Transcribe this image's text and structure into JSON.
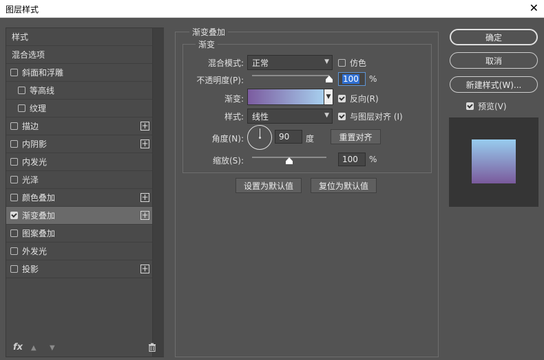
{
  "window": {
    "title": "图层样式",
    "close_glyph": "✕"
  },
  "left_panel": {
    "items": [
      {
        "label": "样式",
        "type": "header"
      },
      {
        "label": "混合选项",
        "type": "header"
      },
      {
        "label": "斜面和浮雕",
        "checked": false,
        "indent": 0,
        "plus": false
      },
      {
        "label": "等高线",
        "checked": false,
        "indent": 1,
        "plus": false
      },
      {
        "label": "纹理",
        "checked": false,
        "indent": 1,
        "plus": false
      },
      {
        "label": "描边",
        "checked": false,
        "indent": 0,
        "plus": true
      },
      {
        "label": "内阴影",
        "checked": false,
        "indent": 0,
        "plus": true
      },
      {
        "label": "内发光",
        "checked": false,
        "indent": 0,
        "plus": false
      },
      {
        "label": "光泽",
        "checked": false,
        "indent": 0,
        "plus": false
      },
      {
        "label": "颜色叠加",
        "checked": false,
        "indent": 0,
        "plus": true
      },
      {
        "label": "渐变叠加",
        "checked": true,
        "indent": 0,
        "plus": true,
        "selected": true
      },
      {
        "label": "图案叠加",
        "checked": false,
        "indent": 0,
        "plus": false
      },
      {
        "label": "外发光",
        "checked": false,
        "indent": 0,
        "plus": false
      },
      {
        "label": "投影",
        "checked": false,
        "indent": 0,
        "plus": true
      }
    ],
    "footer": {
      "fx_label": "fx"
    }
  },
  "gradient_overlay": {
    "group_title": "渐变叠加",
    "sub_title": "渐变",
    "blend_mode_label": "混合模式:",
    "blend_mode_value": "正常",
    "dither_label": "仿色",
    "dither_checked": false,
    "opacity_label": "不透明度(P):",
    "opacity_value": "100",
    "opacity_unit": "%",
    "opacity_fraction": 1.0,
    "gradient_label": "渐变:",
    "gradient_colors": [
      "#7b5b9f",
      "#a7cfee"
    ],
    "reverse_label": "反向(R)",
    "reverse_checked": true,
    "style_label": "样式:",
    "style_value": "线性",
    "align_label": "与图层对齐 (I)",
    "align_checked": true,
    "angle_label": "角度(N):",
    "angle_value": "90",
    "angle_unit": "度",
    "reset_align_label": "重置对齐",
    "scale_label": "缩放(S):",
    "scale_value": "100",
    "scale_unit": "%",
    "scale_fraction": 0.5,
    "set_default_label": "设置为默认值",
    "reset_default_label": "复位为默认值"
  },
  "right_panel": {
    "ok_label": "确定",
    "cancel_label": "取消",
    "new_style_label": "新建样式(W)...",
    "preview_label": "预览(V)",
    "preview_checked": true,
    "preview_colors": [
      "#98cdef",
      "#7a5a9c"
    ]
  }
}
